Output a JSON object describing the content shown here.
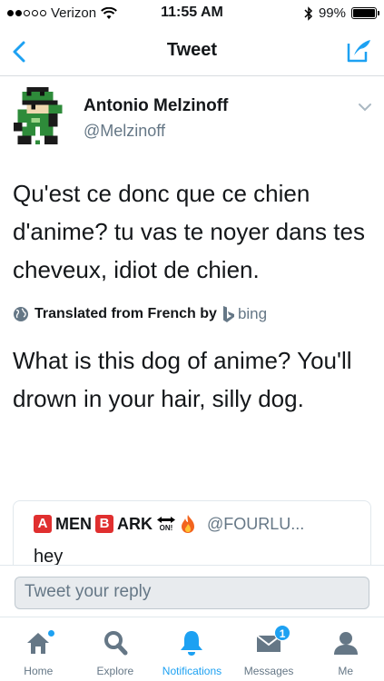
{
  "status_bar": {
    "carrier": "Verizon",
    "time": "11:55 AM",
    "battery": "99%"
  },
  "navbar": {
    "title": "Tweet"
  },
  "tweet": {
    "author_name": "Antonio Melzinoff",
    "author_handle": "@Melzinoff",
    "text": "Qu'est ce donc que ce chien d'anime? tu vas te noyer dans tes cheveux, idiot de chien.",
    "translated_label": "Translated from French by",
    "translator": "bing",
    "translation": "What is this dog of anime? You'll drown in your hair, silly dog."
  },
  "quoted_tweet": {
    "name_parts": [
      "A",
      "MEN",
      "B",
      "ARK",
      "ON!"
    ],
    "handle": "@FOURLU...",
    "text": "hey"
  },
  "reply": {
    "placeholder": "Tweet your reply"
  },
  "tabs": [
    {
      "label": "Home",
      "icon": "home-icon"
    },
    {
      "label": "Explore",
      "icon": "search-icon"
    },
    {
      "label": "Notifications",
      "icon": "bell-icon"
    },
    {
      "label": "Messages",
      "icon": "envelope-icon",
      "badge": "1"
    },
    {
      "label": "Me",
      "icon": "person-icon"
    }
  ],
  "colors": {
    "accent": "#1da1f2",
    "text": "#14171a",
    "muted": "#657786"
  }
}
